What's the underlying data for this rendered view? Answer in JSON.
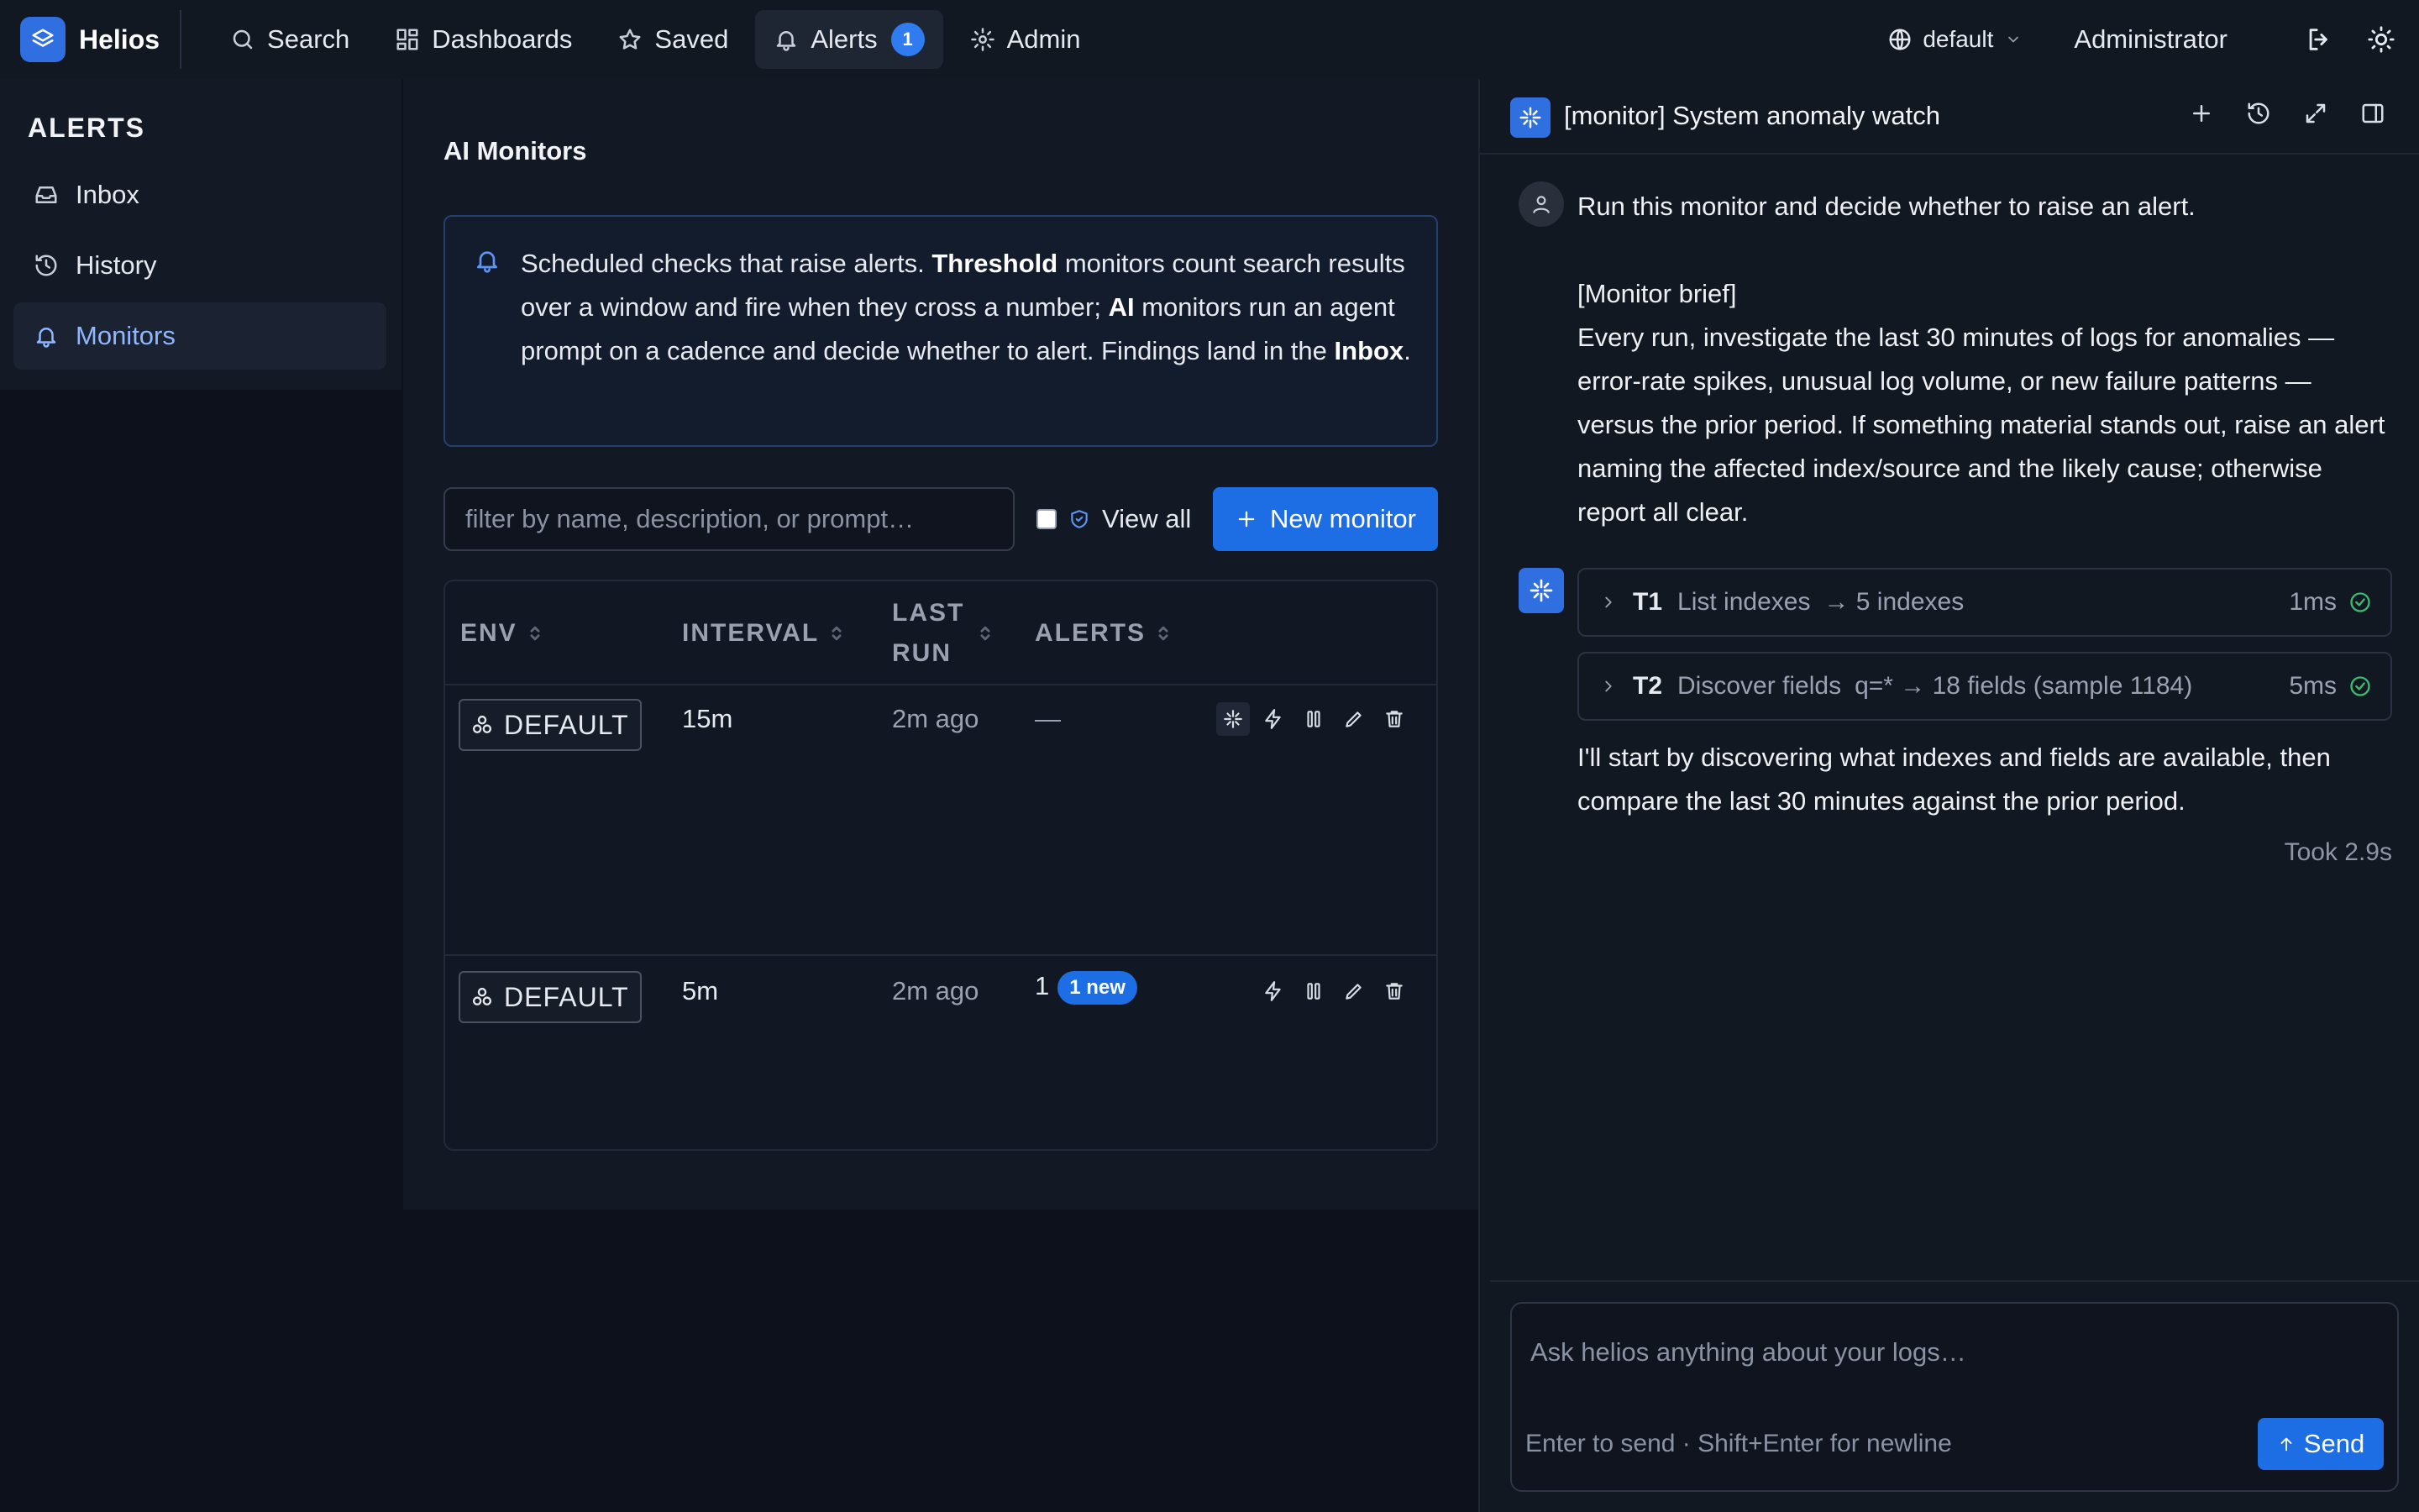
{
  "app": {
    "name": "Helios"
  },
  "nav": {
    "search": "Search",
    "dashboards": "Dashboards",
    "saved": "Saved",
    "alerts": "Alerts",
    "alerts_badge": "1",
    "admin": "Admin"
  },
  "topbar": {
    "env": "default",
    "user": "Administrator"
  },
  "sidebar": {
    "title": "ALERTS",
    "items": [
      {
        "label": "Inbox"
      },
      {
        "label": "History"
      },
      {
        "label": "Monitors"
      }
    ]
  },
  "main": {
    "title": "AI Monitors",
    "info": {
      "p1": "Scheduled checks that raise alerts. ",
      "b1": "Threshold",
      "p2": " monitors count search results over a window and fire when they cross a number; ",
      "b2": "AI",
      "p3": " monitors run an agent prompt on a cadence and decide whether to alert. Findings land in the ",
      "b3": "Inbox",
      "p4": "."
    },
    "filter_placeholder": "filter by name, description, or prompt…",
    "view_all": "View all",
    "new_monitor": "New monitor",
    "columns": {
      "env": "ENV",
      "interval": "INTERVAL",
      "last_run": "LAST RUN",
      "alerts": "ALERTS"
    },
    "rows": [
      {
        "env": "DEFAULT",
        "interval": "15m",
        "last_run": "2m ago",
        "alerts": "—",
        "new_badge": ""
      },
      {
        "env": "DEFAULT",
        "interval": "5m",
        "last_run": "2m ago",
        "alerts": "1",
        "new_badge": "1 new"
      }
    ]
  },
  "chat": {
    "title": "[monitor] System anomaly watch",
    "user_message": {
      "line1": "Run this monitor and decide whether to raise an alert.",
      "brief_heading": "[Monitor brief]",
      "brief": "Every run, investigate the last 30 minutes of logs for anomalies — error-rate spikes, unusual log volume, or new failure patterns — versus the prior period. If something material stands out, raise an alert naming the affected index/source and the likely cause; otherwise report all clear."
    },
    "tools": [
      {
        "id": "T1",
        "name": "List indexes",
        "result": "→ 5 indexes",
        "time": "1ms"
      },
      {
        "id": "T2",
        "name": "Discover fields",
        "result": "q=* → 18 fields (sample 1184)",
        "time": "5ms"
      }
    ],
    "bot_message": "I'll start by discovering what indexes and fields are available, then compare the last 30 minutes against the prior period.",
    "took": "Took 2.9s",
    "composer_placeholder": "Ask helios anything about your logs…",
    "composer_hint": "Enter to send · Shift+Enter for newline",
    "send": "Send"
  },
  "colors": {
    "accent": "#1d6de4",
    "success": "#3dbb72",
    "background": "#0c111c"
  }
}
